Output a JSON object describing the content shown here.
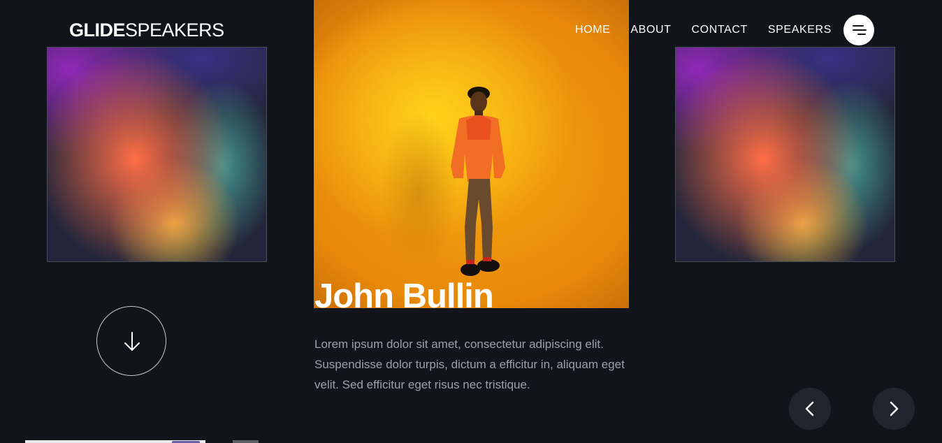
{
  "header": {
    "logo_bold": "GLIDE",
    "logo_light": "SPEAKERS",
    "nav": [
      "HOME",
      "ABOUT",
      "CONTACT",
      "SPEAKERS"
    ],
    "menu_icon": "hamburger-menu-icon"
  },
  "speaker": {
    "name": "John Bullin",
    "bio": "Lorem ipsum dolor sit amet, consectetur adipiscing elit. Suspendisse dolor turpis, dictum a efficitur in, aliquam eget velit. Sed efficitur eget risus nec tristique."
  },
  "controls": {
    "scroll_icon": "arrow-down-icon",
    "prev_icon": "chevron-left-icon",
    "next_icon": "chevron-right-icon"
  },
  "colors": {
    "background": "#12141c",
    "photo_accent": "#f5a50e",
    "bio_text": "#9aa0ab",
    "arrow_button": "#22252e"
  }
}
